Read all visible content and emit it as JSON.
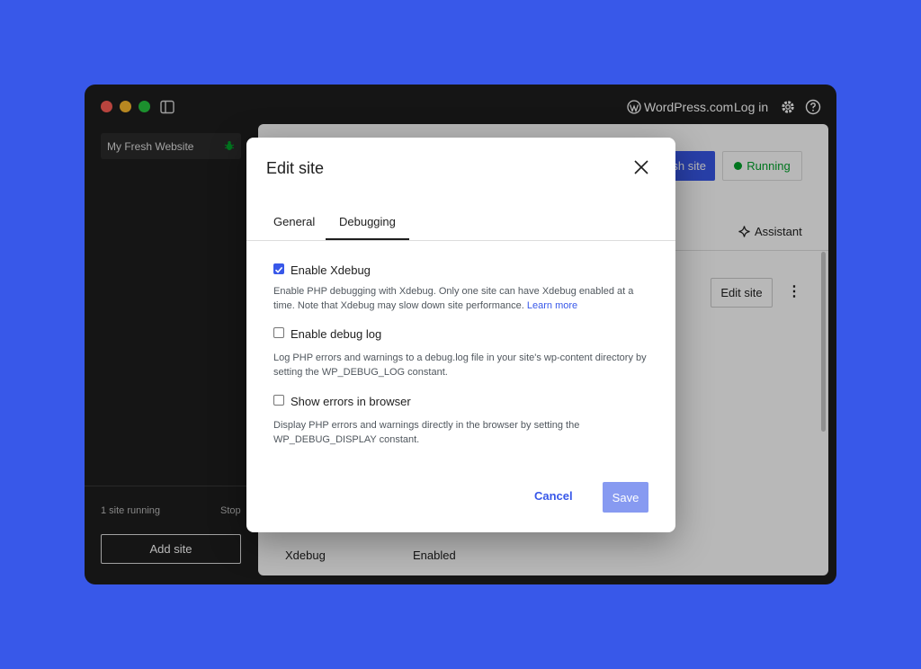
{
  "titlebar": {
    "brand": "WordPress.com",
    "login_label": "Log in"
  },
  "sidebar": {
    "site_name": "My Fresh Website",
    "running_status": "1 site running",
    "stop_label": "Stop",
    "add_site_label": "Add site"
  },
  "main": {
    "publish_label": "sh site",
    "running_label": "Running",
    "assistant_label": "Assistant",
    "edit_site_label": "Edit site",
    "more_glyph": "⋮",
    "xdebug_label": "Xdebug",
    "xdebug_value": "Enabled"
  },
  "modal": {
    "title": "Edit site",
    "tabs": [
      {
        "label": "General",
        "active": false
      },
      {
        "label": "Debugging",
        "active": true
      }
    ],
    "options": [
      {
        "label": "Enable Xdebug",
        "checked": true,
        "help": "Enable PHP debugging with Xdebug. Only one site can have Xdebug enabled at a time. Note that Xdebug may slow down site performance.",
        "link": "Learn more"
      },
      {
        "label": "Enable debug log",
        "checked": false,
        "help": "Log PHP errors and warnings to a debug.log file in your site's wp-content directory by setting the WP_DEBUG_LOG constant."
      },
      {
        "label": "Show errors in browser",
        "checked": false,
        "help": "Display PHP errors and warnings directly in the browser by setting the WP_DEBUG_DISPLAY constant."
      }
    ],
    "cancel_label": "Cancel",
    "save_label": "Save"
  },
  "colors": {
    "background": "#3858e9",
    "accent": "#3858e9",
    "window": "#1e1e1e",
    "running": "#00a32a"
  },
  "icons": [
    "sidebar-toggle-icon",
    "wordpress-icon",
    "gear-icon",
    "help-icon",
    "bug-icon",
    "sparkle-icon",
    "close-icon",
    "check-icon",
    "more-vertical-icon"
  ]
}
